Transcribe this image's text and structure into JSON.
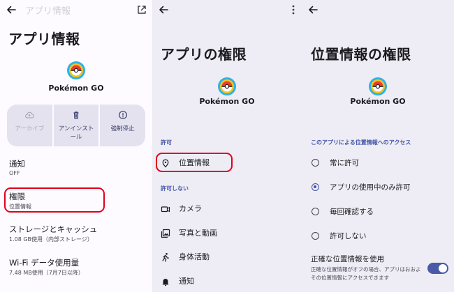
{
  "panels": {
    "app_info": {
      "faded_title": "アプリ情報",
      "title": "アプリ情報",
      "app_name": "Pokémon GO",
      "actions": [
        {
          "label": "アーカイブ",
          "icon": "cloud-upload-icon",
          "enabled": false
        },
        {
          "label": "アンインストール",
          "icon": "trash-icon",
          "enabled": true
        },
        {
          "label": "強制停止",
          "icon": "stop-icon",
          "enabled": true
        }
      ],
      "rows": {
        "notifications": {
          "title": "通知",
          "sub": "OFF"
        },
        "permissions": {
          "title": "権限",
          "sub": "位置情報"
        },
        "storage": {
          "title": "ストレージとキャッシュ",
          "sub": "1.08 GB使用（内部ストレージ）"
        },
        "wifi": {
          "title": "Wi-Fi データ使用量",
          "sub": "7.48 MB使用（7月7日以降）"
        }
      }
    },
    "app_permissions": {
      "title": "アプリの権限",
      "app_name": "Pokémon GO",
      "allowed_label": "許可",
      "allowed": [
        {
          "label": "位置情報",
          "icon": "location-pin-icon"
        }
      ],
      "denied_label": "許可しない",
      "denied": [
        {
          "label": "カメラ",
          "icon": "camera-icon"
        },
        {
          "label": "写真と動画",
          "icon": "photos-icon"
        },
        {
          "label": "身体活動",
          "icon": "running-icon"
        },
        {
          "label": "通知",
          "icon": "bell-icon"
        }
      ]
    },
    "location_permission": {
      "title": "位置情報の権限",
      "app_name": "Pokémon GO",
      "section_label": "このアプリによる位置情報へのアクセス",
      "options": [
        {
          "label": "常に許可",
          "selected": false
        },
        {
          "label": "アプリの使用中のみ許可",
          "selected": true
        },
        {
          "label": "毎回確認する",
          "selected": false
        },
        {
          "label": "許可しない",
          "selected": false
        }
      ],
      "precise": {
        "title": "正確な位置情報を使用",
        "desc": "正確な位置情報がオフの場合、アプリはおおよその位置情報にアクセスできます",
        "enabled": true
      }
    }
  },
  "colors": {
    "accent": "#4355a8",
    "highlight": "#e2001a",
    "panel_bg": "#eeecf4",
    "card_bg": "#e4e2ef"
  }
}
